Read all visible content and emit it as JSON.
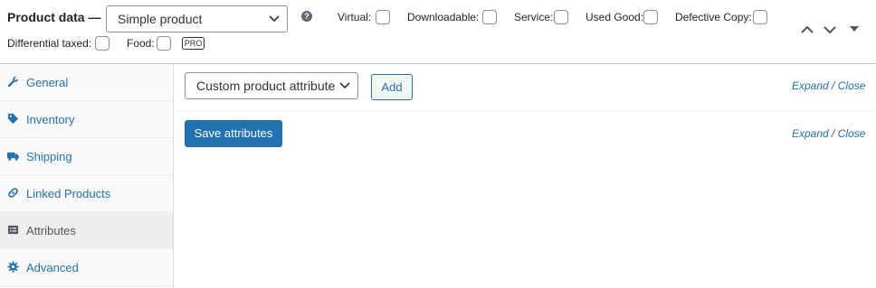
{
  "header": {
    "title": "Product data —",
    "product_type": "Simple product",
    "help_icon": "question-icon",
    "options": [
      {
        "label": "Virtual:",
        "checked": false
      },
      {
        "label": "Downloadable:",
        "checked": false
      },
      {
        "label": "Service:",
        "checked": false
      },
      {
        "label": "Used Good:",
        "checked": false
      },
      {
        "label": "Defective Copy:",
        "checked": false
      },
      {
        "label": "Differential taxed:",
        "checked": false
      },
      {
        "label": "Food:",
        "checked": false
      }
    ],
    "pro_badge": "PRO"
  },
  "sidebar": {
    "items": [
      {
        "label": "General",
        "icon": "wrench-icon"
      },
      {
        "label": "Inventory",
        "icon": "tag-icon"
      },
      {
        "label": "Shipping",
        "icon": "truck-icon"
      },
      {
        "label": "Linked Products",
        "icon": "link-icon"
      },
      {
        "label": "Attributes",
        "icon": "list-icon",
        "active": true
      },
      {
        "label": "Advanced",
        "icon": "gear-icon"
      }
    ]
  },
  "attributes": {
    "select_value": "Custom product attribute",
    "add_label": "Add",
    "expand_label": "Expand",
    "close_label": "Close",
    "separator": "/",
    "save_label": "Save attributes"
  },
  "colors": {
    "accent": "#2271b1",
    "text": "#1d2327",
    "sidebar_bg": "#fafafa",
    "active_tab_bg": "#eeeeee"
  }
}
